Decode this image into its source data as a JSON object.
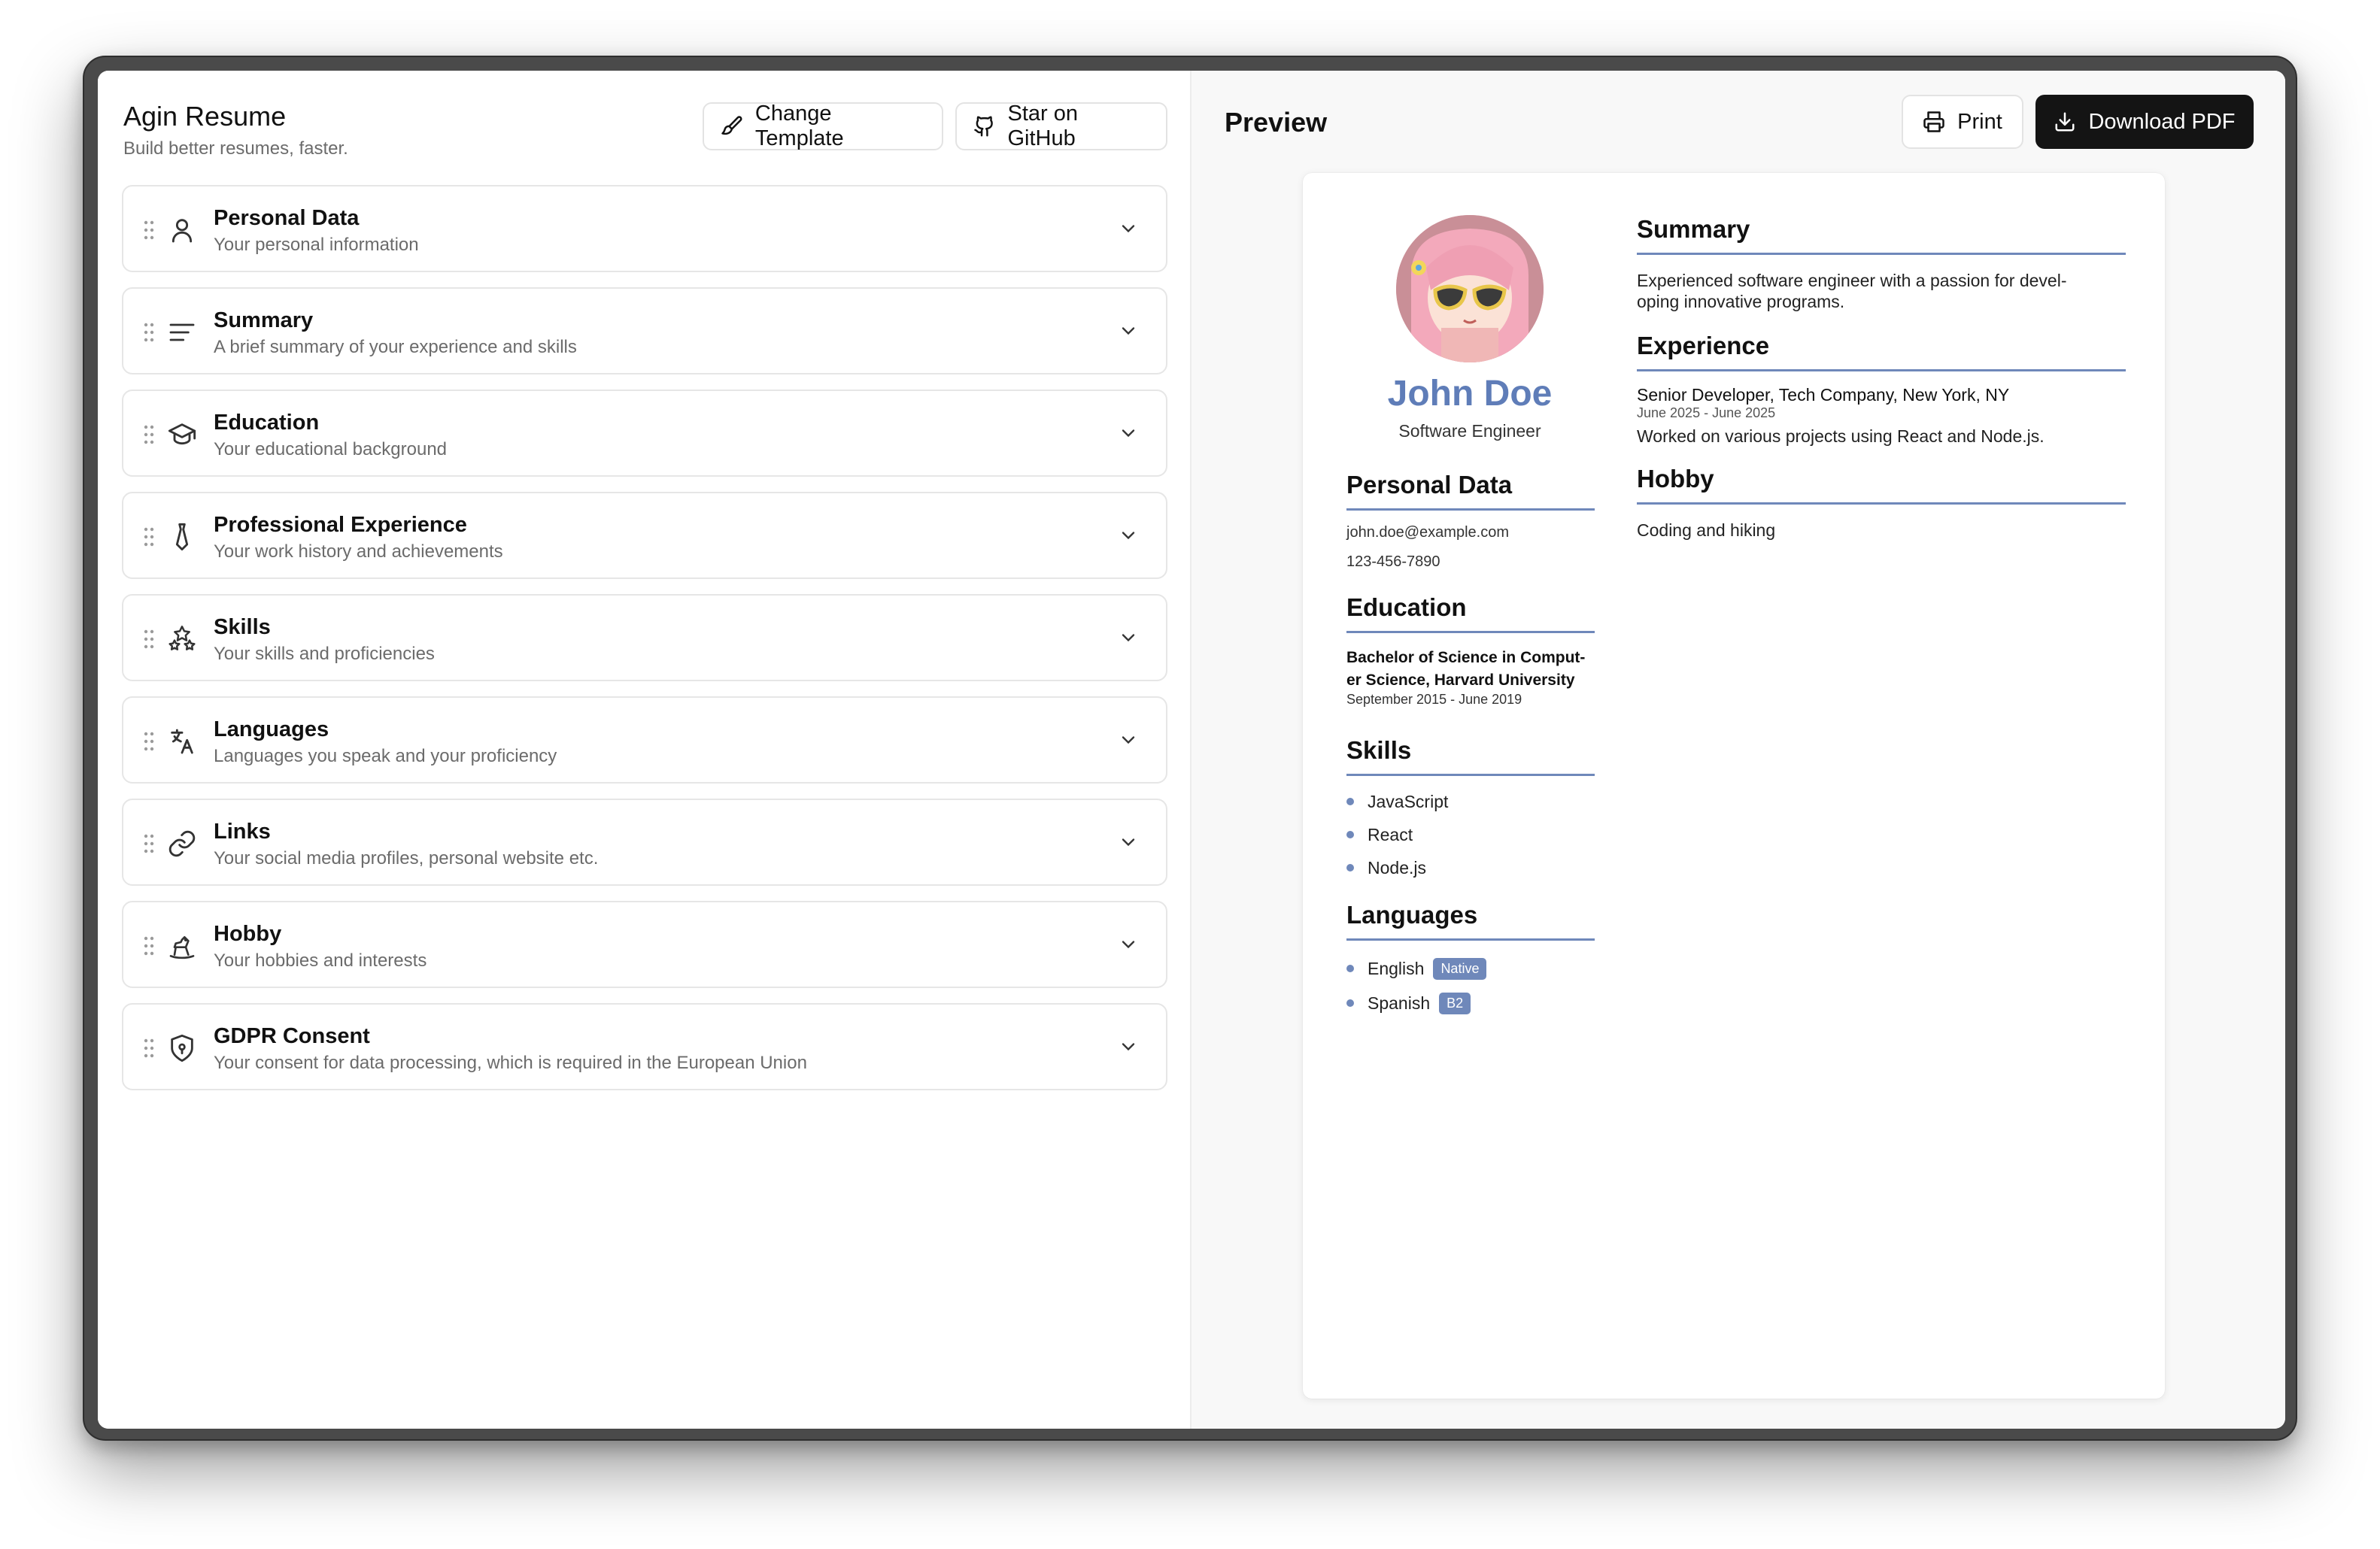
{
  "app": {
    "title": "Agin Resume",
    "subtitle": "Build better resumes, faster.",
    "change_template_label": "Change Template",
    "github_label": "Star on GitHub"
  },
  "sections": [
    {
      "title": "Personal Data",
      "subtitle": "Your personal information",
      "icon": "user-icon"
    },
    {
      "title": "Summary",
      "subtitle": "A brief summary of your experience and skills",
      "icon": "text-lines-icon"
    },
    {
      "title": "Education",
      "subtitle": "Your educational background",
      "icon": "graduation-cap-icon"
    },
    {
      "title": "Professional Experience",
      "subtitle": "Your work history and achievements",
      "icon": "tie-icon"
    },
    {
      "title": "Skills",
      "subtitle": "Your skills and proficiencies",
      "icon": "stars-icon"
    },
    {
      "title": "Languages",
      "subtitle": "Languages you speak and your proficiency",
      "icon": "translate-icon"
    },
    {
      "title": "Links",
      "subtitle": "Your social media profiles, personal website etc.",
      "icon": "link-icon"
    },
    {
      "title": "Hobby",
      "subtitle": "Your hobbies and interests",
      "icon": "rocking-horse-icon"
    },
    {
      "title": "GDPR Consent",
      "subtitle": "Your consent for data processing, which is required in the European Union",
      "icon": "shield-icon"
    }
  ],
  "preview": {
    "title": "Preview",
    "print_label": "Print",
    "download_label": "Download PDF"
  },
  "resume": {
    "name": "John Doe",
    "role": "Software Engineer",
    "personal_heading": "Personal Data",
    "email": "john.doe@example.com",
    "phone": "123-456-7890",
    "education_heading": "Education",
    "education_line1": "Bachelor of Science in Comput-",
    "education_line2": "er Science, Harvard University",
    "education_dates": "September 2015 - June 2019",
    "skills_heading": "Skills",
    "skills": [
      "JavaScript",
      "React",
      "Node.js"
    ],
    "languages_heading": "Languages",
    "languages": [
      {
        "name": "English",
        "level": "Native"
      },
      {
        "name": "Spanish",
        "level": "B2"
      }
    ],
    "summary_heading": "Summary",
    "summary_line1": "Experienced software engineer with a passion for devel-",
    "summary_line2": "oping innovative programs.",
    "experience_heading": "Experience",
    "job_title": "Senior Developer, Tech Company, New York, NY",
    "job_dates": "June 2025 - June 2025",
    "job_description": "Worked on various projects using React and Node.js.",
    "hobby_heading": "Hobby",
    "hobby": "Coding and hiking"
  },
  "colors": {
    "accent": "#6f88ba",
    "name": "#5f7db8",
    "download_button": "#141414"
  }
}
